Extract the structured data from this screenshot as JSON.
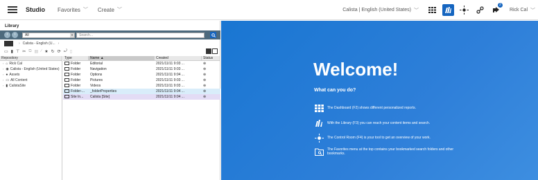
{
  "topbar": {
    "app_title": "Studio",
    "menu_favorites": "Favorites",
    "menu_create": "Create",
    "locale": "Calista | English (United States)",
    "user": "Rick Cal",
    "notification_count": "2"
  },
  "library": {
    "title": "Library",
    "search_scope": "All",
    "search_placeholder": "Search...",
    "breadcrumb_site": "Calista - English (U...",
    "tree_header": "Repository",
    "tree_items": [
      {
        "label": "Rick Cal",
        "icon": "home-icon"
      },
      {
        "label": "Calista - English (United States)",
        "icon": "site-icon"
      },
      {
        "label": "Assets",
        "icon": "assets-icon"
      },
      {
        "label": "All Content",
        "icon": "folder-icon"
      },
      {
        "label": "CalistaSite",
        "icon": "document-icon"
      }
    ],
    "columns": {
      "type": "Type",
      "name": "Name ▲",
      "created": "Created",
      "status": "Status"
    },
    "rows": [
      {
        "type": "Folder",
        "name": "Editorial",
        "created": "2021/11/11 9:03 ..."
      },
      {
        "type": "Folder",
        "name": "Navigation",
        "created": "2021/11/11 9:03 ..."
      },
      {
        "type": "Folder",
        "name": "Options",
        "created": "2021/11/11 9:04 ..."
      },
      {
        "type": "Folder",
        "name": "Pictures",
        "created": "2021/11/11 9:03 ..."
      },
      {
        "type": "Folder",
        "name": "Videos",
        "created": "2021/11/11 9:03 ..."
      },
      {
        "type": "Folder-...",
        "name": "_folderProperties",
        "created": "2021/11/11 9:04 ..."
      },
      {
        "type": "Site In...",
        "name": "Calista [Site]",
        "created": "2021/11/11 9:04 ..."
      }
    ]
  },
  "welcome": {
    "title": "Welcome!",
    "subtitle": "What can you do?",
    "items": [
      "The Dashboard (F2) shows different personalized reports.",
      "With the Library (F3) you can reach your content items and search.",
      "The Control Room (F4) is your tool to get an overview of your work.",
      "The Favorites menu at the top contains your bookmarked search folders and other bookmarks."
    ]
  },
  "colors": {
    "accent": "#1565c0",
    "welcome_bg": "#1e78d6",
    "searchbar": "#4d6a7d"
  }
}
